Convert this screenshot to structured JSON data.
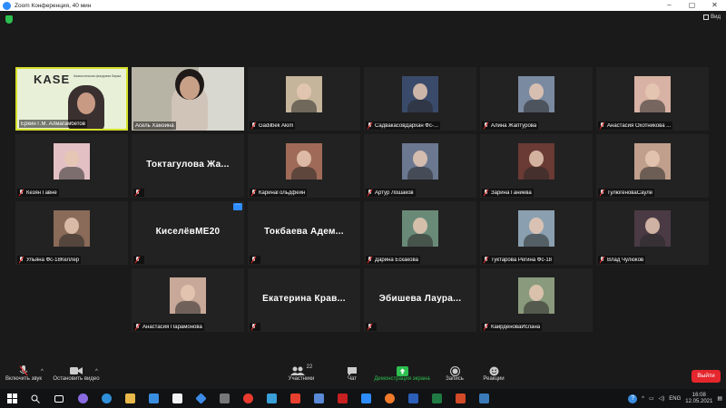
{
  "window": {
    "title": "Zoom Конференция, 40 мин"
  },
  "header": {
    "view_label": "Вид"
  },
  "participants": [
    {
      "name": "Еркин Г.М. Алмагамбетов",
      "kind": "video",
      "bg": "#e8f1d8",
      "active": true
    },
    {
      "name": "Асель Хамзина",
      "kind": "video",
      "bg": "#b7b3a5"
    },
    {
      "name": "Gadilbek Akim",
      "kind": "photo",
      "bg": "#c5b59a"
    },
    {
      "name": "СадвакасовДархан Фс-...",
      "kind": "photo",
      "bg": "#3a4a6a"
    },
    {
      "name": "Алина Жаптурова",
      "kind": "photo",
      "bg": "#7a8aa0"
    },
    {
      "name": "Анастасия Охотникова ...",
      "kind": "photo",
      "bg": "#d8b2a4"
    },
    {
      "name": "Кезян Гавне",
      "kind": "photo",
      "bg": "#e3c0c4"
    },
    {
      "name": "",
      "kind": "text",
      "big": "Токтагулова Жа..."
    },
    {
      "name": "КаринаГольдфейн",
      "kind": "photo",
      "bg": "#a06a58"
    },
    {
      "name": "Артур Лошаков",
      "kind": "photo",
      "bg": "#6b7890"
    },
    {
      "name": "Зарина Ганиева",
      "kind": "photo",
      "bg": "#6a3a34"
    },
    {
      "name": "ТулюгеноваСауле",
      "kind": "photo",
      "bg": "#c0a08c"
    },
    {
      "name": "Ульяна Фс-18Келлер",
      "kind": "photo",
      "bg": "#8a6a58"
    },
    {
      "name": "",
      "kind": "text",
      "big": "КиселёвME20",
      "more": true
    },
    {
      "name": "",
      "kind": "text",
      "big": "Токбаева Адем..."
    },
    {
      "name": "Дарина Ескакова",
      "kind": "photo",
      "bg": "#6a8a78"
    },
    {
      "name": "Туктарова Регина Фс-18",
      "kind": "photo",
      "bg": "#8aa0b0"
    },
    {
      "name": "Влад Чулюков",
      "kind": "photo",
      "bg": "#4a3a44"
    },
    {
      "name": "Анастасия Парамонова",
      "kind": "photo",
      "bg": "#c8a898"
    },
    {
      "name": "",
      "kind": "text",
      "big": "Екатерина Крав..."
    },
    {
      "name": "",
      "kind": "text",
      "big": "Эбишева Лаура..."
    },
    {
      "name": "КаирденоваИслана",
      "kind": "photo",
      "bg": "#8a9a7c"
    }
  ],
  "kase": {
    "logo": "KASE",
    "tagline": "Казахстанская фондовая биржа"
  },
  "toolbar": {
    "unmute": "Включить звук",
    "stop_video": "Остановить видео",
    "participants": "Участники",
    "participants_count": "22",
    "chat": "Чат",
    "share": "Демонстрация экрана",
    "record": "Запись",
    "reactions": "Реакции",
    "end": "Выйти"
  },
  "taskbar": {
    "lang": "ENG",
    "time": "16:08",
    "date": "12.05.2021"
  },
  "colors": {
    "accent": "#2d8cff",
    "share_green": "#2dbf4f",
    "end_red": "#e5262d",
    "active_border": "#d6e02a"
  }
}
